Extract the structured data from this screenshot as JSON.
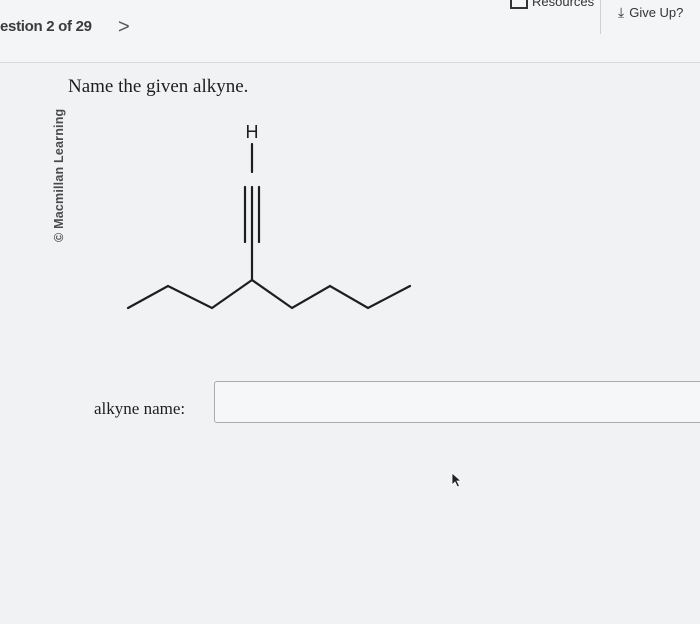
{
  "header": {
    "question_counter": "estion 2 of 29",
    "next_glyph": ">",
    "resources_label": "Resources",
    "give_up_label": "Give Up?"
  },
  "question": {
    "watermark": "© Macmillan Learning",
    "prompt": "Name the given alkyne.",
    "structure_atom_label": "H",
    "answer_label": "alkyne name:",
    "answer_value": ""
  },
  "icons": {
    "resources": "resources-icon",
    "give_up": "give-up-icon",
    "pointer": "mouse-pointer-icon"
  }
}
